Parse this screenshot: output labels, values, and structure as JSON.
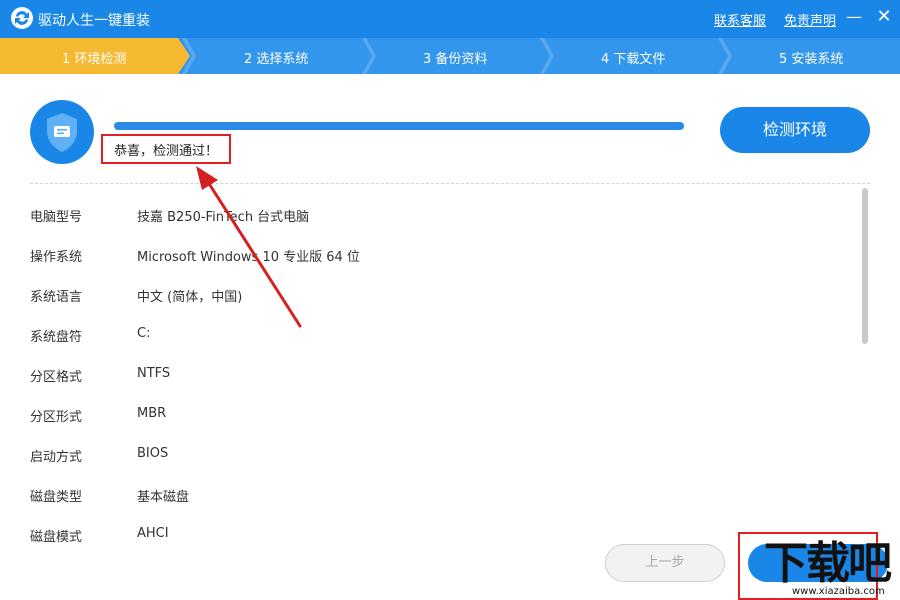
{
  "window": {
    "title": "驱动人生一键重装",
    "links": {
      "contact": "联系客服",
      "disclaimer": "免责声明"
    },
    "controls": {
      "minimize": "—",
      "close": "✕"
    },
    "accent_color": "#1a87e8"
  },
  "steps": [
    {
      "label": "1 环境检测",
      "active": true
    },
    {
      "label": "2 选择系统",
      "active": false
    },
    {
      "label": "3 备份资料",
      "active": false
    },
    {
      "label": "4 下载文件",
      "active": false
    },
    {
      "label": "5 安装系统",
      "active": false
    }
  ],
  "detection": {
    "progress_fraction": 1.0,
    "status": "恭喜，检测通过！",
    "button_label": "检测环境",
    "icon": "shield-icon"
  },
  "info": [
    {
      "key": "电脑型号",
      "value": "技嘉 B250-FinTech 台式电脑"
    },
    {
      "key": "操作系统",
      "value": "Microsoft Windows 10 专业版 64 位"
    },
    {
      "key": "系统语言",
      "value": "中文 (简体，中国)"
    },
    {
      "key": "系统盘符",
      "value": "C:"
    },
    {
      "key": "分区格式",
      "value": "NTFS"
    },
    {
      "key": "分区形式",
      "value": "MBR"
    },
    {
      "key": "启动方式",
      "value": "BIOS"
    },
    {
      "key": "磁盘类型",
      "value": "基本磁盘"
    },
    {
      "key": "磁盘模式",
      "value": "AHCI"
    }
  ],
  "footer": {
    "prev_label": "上一步"
  },
  "watermark": {
    "text": "下载吧",
    "url": "www.xiazaiba.com"
  }
}
